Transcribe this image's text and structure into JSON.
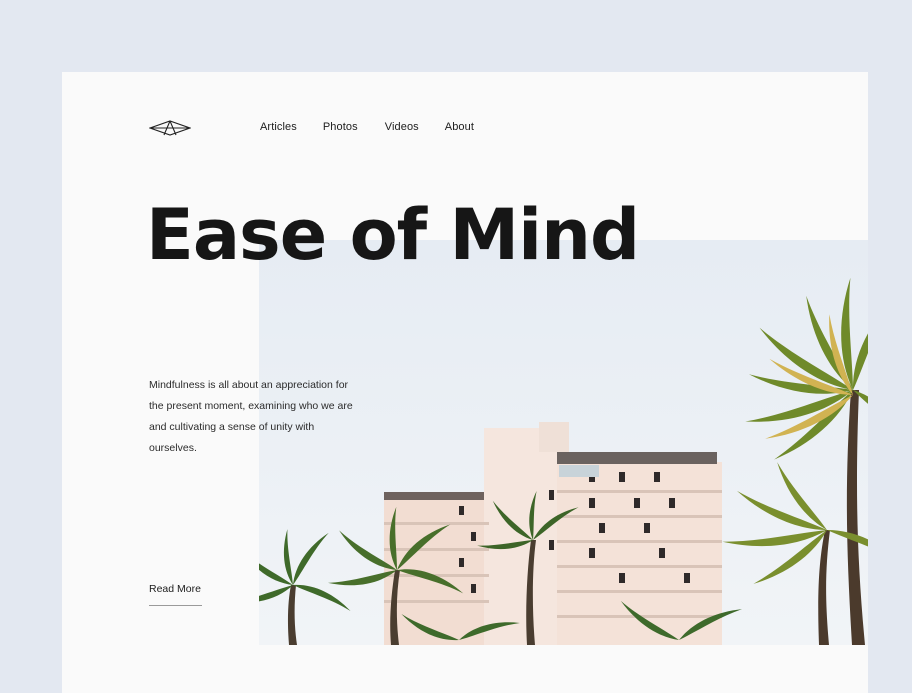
{
  "nav": {
    "items": [
      "Articles",
      "Photos",
      "Videos",
      "About"
    ]
  },
  "hero": {
    "title": "Ease of Mind",
    "description": "Mindfulness is all about an appreciation for the present moment, examining who we are and cultivating a sense of unity with ourselves.",
    "cta_label": "Read More"
  },
  "icons": {
    "logo": "diamond-logo-icon"
  },
  "colors": {
    "page_bg": "#e3e8f1",
    "card_bg": "#fafafa",
    "text": "#161616",
    "sky": "#e7edf3"
  }
}
